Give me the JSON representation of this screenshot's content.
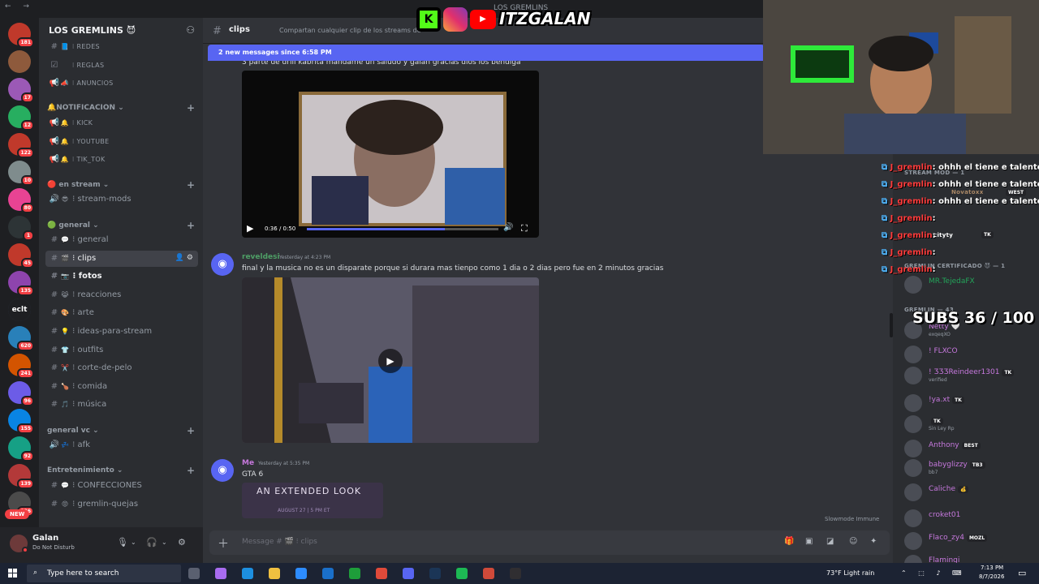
{
  "window": {
    "title": "LOS GREMLINS",
    "nav": "← →"
  },
  "servers": [
    {
      "badge": "181",
      "color": "#c0392b"
    },
    {
      "badge": "",
      "color": "#8e5a3c"
    },
    {
      "badge": "17",
      "color": "#9b59b6"
    },
    {
      "badge": "12",
      "color": "#27ae60"
    },
    {
      "badge": "122",
      "color": "#c0392b"
    },
    {
      "badge": "10",
      "color": "#7f8c8d"
    },
    {
      "badge": "80",
      "color": "#e84393"
    },
    {
      "badge": "1",
      "color": "#2d3436"
    },
    {
      "badge": "45",
      "color": "#c0392b"
    },
    {
      "badge": "135",
      "color": "#8e44ad"
    },
    {
      "badge": "",
      "color": "#34495e",
      "text": "eclt"
    },
    {
      "badge": "620",
      "color": "#2980b9"
    },
    {
      "badge": "241",
      "color": "#d35400"
    },
    {
      "badge": "96",
      "color": "#6c5ce7"
    },
    {
      "badge": "155",
      "color": "#0984e3"
    },
    {
      "badge": "92",
      "color": "#16a085"
    },
    {
      "badge": "139",
      "color": "#b33939"
    },
    {
      "badge": "226",
      "color": "#4b4b4b"
    }
  ],
  "new_pill": "NEW",
  "guild": {
    "name": "LOS GREMLINS 😈",
    "chevron": "⌄"
  },
  "channels": {
    "top": [
      {
        "icon": "#",
        "emoji": "📘",
        "name": "REDES"
      },
      {
        "icon": "☑",
        "emoji": "",
        "name": "REGLAS"
      },
      {
        "icon": "📢",
        "emoji": "📣",
        "name": "ANUNCIOS"
      }
    ],
    "cat_notif": "🔔NOTIFICACION ⌄",
    "notif": [
      {
        "icon": "📢",
        "emoji": "🔔",
        "name": "KICK"
      },
      {
        "icon": "📢",
        "emoji": "🔔",
        "name": "YOUTUBE"
      },
      {
        "icon": "📢",
        "emoji": "🔔",
        "name": "TIK_TOK"
      }
    ],
    "cat_stream": "🔴 en stream ⌄",
    "stream": [
      {
        "icon": "🔊",
        "emoji": "😎",
        "name": "stream-mods"
      }
    ],
    "cat_general": "🟢 general ⌄",
    "general": [
      {
        "icon": "#",
        "emoji": "💬",
        "name": "general"
      },
      {
        "icon": "#",
        "emoji": "🎬",
        "name": "clips"
      },
      {
        "icon": "#",
        "emoji": "📷",
        "name": "fotos"
      },
      {
        "icon": "#",
        "emoji": "😹",
        "name": "reacciones"
      },
      {
        "icon": "#",
        "emoji": "🎨",
        "name": "arte"
      },
      {
        "icon": "#",
        "emoji": "💡",
        "name": "ideas-para-stream"
      },
      {
        "icon": "#",
        "emoji": "👕",
        "name": "outfits"
      },
      {
        "icon": "#",
        "emoji": "✂️",
        "name": "corte-de-pelo"
      },
      {
        "icon": "#",
        "emoji": "🍗",
        "name": "comida"
      },
      {
        "icon": "#",
        "emoji": "🎵",
        "name": "música"
      }
    ],
    "cat_vc": "general vc ⌄",
    "vc": [
      {
        "icon": "🔊",
        "emoji": "💤",
        "name": "afk"
      }
    ],
    "cat_ent": "Entretenimiento ⌄",
    "ent": [
      {
        "icon": "#",
        "emoji": "💬",
        "name": "CONFECCIONES"
      },
      {
        "icon": "#",
        "emoji": "😡",
        "name": "gremlin-quejas"
      }
    ]
  },
  "user": {
    "name": "Galan",
    "status": "Do Not Disturb"
  },
  "header": {
    "channel": "clips",
    "topic": "Compartan cualquier clip de los streams de"
  },
  "new_messages_bar": "2 new messages since 6:58 PM",
  "messages": [
    {
      "text_top": "3 parte de drill kabrita mandame un saludo y galan gracias dios los bendiga",
      "video_time": "0:36 / 0:50"
    },
    {
      "author": "reveldesi",
      "time": "Yesterday at 4:23 PM",
      "text": "final  y la musica no es un disparate porque si durara mas tienpo como 1 dia o 2 dias pero fue en 2 minutos gracias"
    },
    {
      "author": "Me",
      "time": "Yesterday at 5:35 PM",
      "text": "GTA 6",
      "embed_title": "AN EXTENDED LOOK",
      "embed_sub": "AUGUST 27 | 5 PM ET"
    }
  ],
  "slowmode": "Slowmode Immune",
  "composer": {
    "placeholder": "Message # 🎬 ⁝ clips"
  },
  "overlay_logo": "ITZGALAN",
  "chat_lines": [
    {
      "user": "J_gremlin",
      "text": ": ohhh el tiene e talento p"
    },
    {
      "user": "J_gremlin",
      "text": ": ohhh el tiene e talento p"
    },
    {
      "user": "J_gremlin",
      "text": ": ohhh el tiene e talento p"
    },
    {
      "user": "J_gremlin",
      "text": ":"
    },
    {
      "user": "J_gremlin",
      "text": ":"
    },
    {
      "user": "J_gremlin",
      "text": ":"
    },
    {
      "user": "J_gremlin",
      "text": ":"
    }
  ],
  "members": {
    "cat_mod": "STREAM MOD — 1",
    "mod_names": [
      "Novatoxx",
      "cityty"
    ],
    "mod_tags": [
      "WEST",
      "TK"
    ],
    "cat_cert": "GREMLIN CERTIFICADO 😈 — 1",
    "cert": [
      {
        "name": "MR.TejedaFX",
        "color": "#23a55a"
      }
    ],
    "cat_gremlin": "GREMLIN — 43",
    "list": [
      {
        "name": "Netty 🤍",
        "sub": "exqeqXO",
        "tag": "",
        "color": "#c678dd"
      },
      {
        "name": "! FLXCO",
        "sub": "",
        "tag": "",
        "color": "#c678dd"
      },
      {
        "name": "! ƷƷƷReindeer1301",
        "sub": "verified",
        "tag": "TK",
        "color": "#c678dd"
      },
      {
        "name": "!ya.xt",
        "sub": "",
        "tag": "TK",
        "color": "#c678dd"
      },
      {
        "name": "",
        "sub": "Sin Ley Rp",
        "tag": "TK",
        "color": "#c678dd"
      },
      {
        "name": "Anthony",
        "sub": "",
        "tag": "BEST",
        "color": "#c678dd"
      },
      {
        "name": "babyglizzy",
        "sub": "bb7",
        "tag": "TB3",
        "color": "#c678dd"
      },
      {
        "name": "Caliche",
        "sub": "",
        "tag": "💰",
        "color": "#c678dd"
      },
      {
        "name": "croket01",
        "sub": "",
        "tag": "",
        "color": "#c678dd"
      },
      {
        "name": "Flaco_zy4",
        "sub": "",
        "tag": "MOZL",
        "color": "#c678dd"
      },
      {
        "name": "Flamingi",
        "sub": "",
        "tag": "",
        "color": "#c678dd"
      }
    ]
  },
  "subs_counter": "SUBS 36 / 100",
  "taskbar": {
    "search": "Type here to search",
    "weather": "73°F  Light rain",
    "time": "7:13 PM",
    "date": "8/7/2026"
  }
}
